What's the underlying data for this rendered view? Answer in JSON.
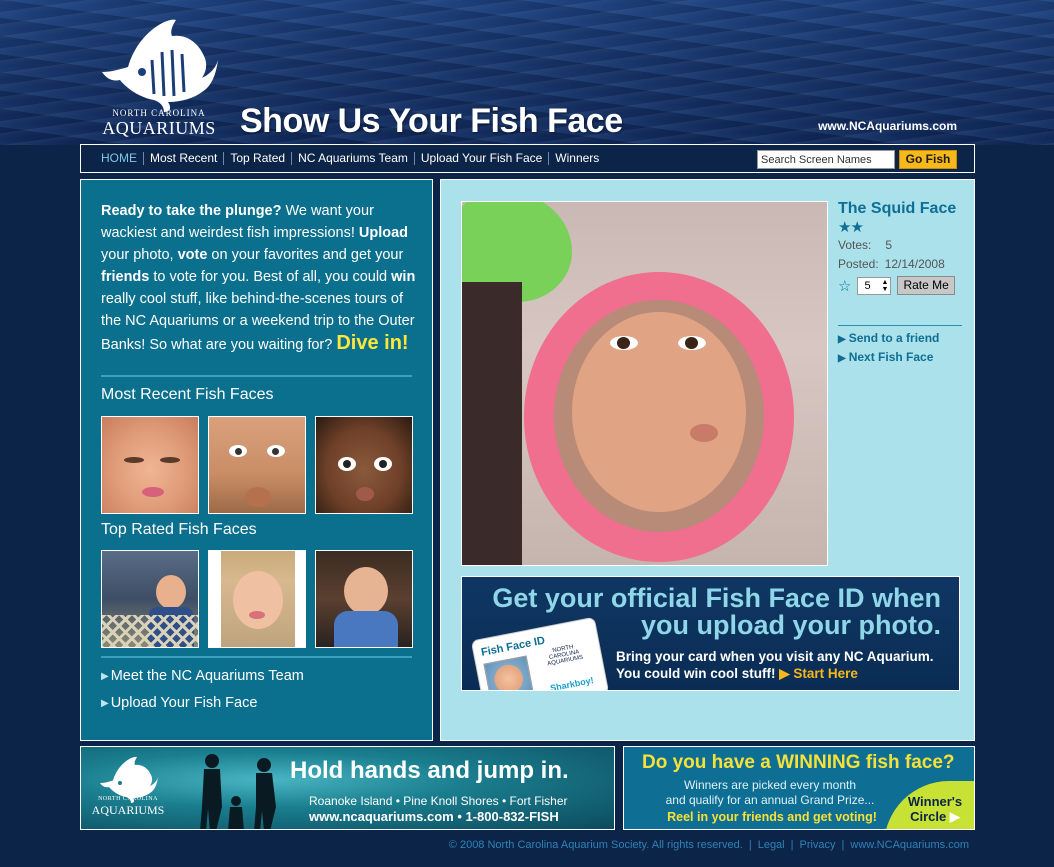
{
  "header": {
    "logo_sub": "NORTH CAROLINA",
    "logo_main": "AQUARIUMS",
    "title": "Show Us Your Fish Face",
    "site_url": "www.NCAquariums.com"
  },
  "nav": {
    "items": [
      {
        "label": "HOME",
        "active": true
      },
      {
        "label": "Most Recent"
      },
      {
        "label": "Top Rated"
      },
      {
        "label": "NC Aquariums Team"
      },
      {
        "label": "Upload Your Fish Face"
      },
      {
        "label": "Winners"
      }
    ],
    "search_placeholder": "Search Screen Names",
    "search_button": "Go Fish"
  },
  "left": {
    "intro_bold1": "Ready to take the plunge?",
    "intro_t1": " We want your wackiest and weirdest fish impressions! ",
    "intro_bold2": "Upload",
    "intro_t2": " your photo, ",
    "intro_bold3": "vote",
    "intro_t3": " on your favorites and get your ",
    "intro_bold4": "friends",
    "intro_t4": " to vote for you. Best of all, you could ",
    "intro_bold5": "win",
    "intro_t5": " really cool stuff, like behind-the-scenes tours of the NC Aquariums or a weekend trip to the Outer Banks! So what are you waiting for? ",
    "intro_dive": "Dive in!",
    "most_recent_title": "Most Recent Fish Faces",
    "top_rated_title": "Top Rated Fish Faces",
    "link_team": "Meet the NC Aquariums Team",
    "link_upload": "Upload Your Fish Face"
  },
  "featured": {
    "title": "The Squid Face",
    "stars": "★★",
    "votes_label": "Votes:",
    "votes_value": "5",
    "posted_label": "Posted:",
    "posted_value": "12/14/2008",
    "rating_value": "5",
    "rate_button": "Rate Me",
    "link_send": "Send to a friend",
    "link_next": "Next Fish Face"
  },
  "id_banner": {
    "headline_line1": "Get your official Fish Face ID when",
    "headline_line2": "you upload your photo.",
    "sub_line1": "Bring your card when you visit any NC Aquarium.",
    "sub_line2": "You could win cool stuff!",
    "cta": "Start Here",
    "card_label": "Fish Face ID",
    "card_logo": "NORTH CAROLINA AQUARIUMS",
    "card_name": "Sharkboy!"
  },
  "banner_left": {
    "logo_sub": "NORTH CAROLINA",
    "logo_main": "AQUARIUMS",
    "headline": "Hold hands and jump in.",
    "places": "Roanoke Island  •  Pine Knoll Shores  •  Fort Fisher",
    "contact": "www.ncaquariums.com  •  1-800-832-FISH"
  },
  "banner_right": {
    "headline": "Do you have a WINNING fish face?",
    "sub_line1": "Winners are picked every month",
    "sub_line2": "and qualify for an annual Grand Prize...",
    "cta": "Reel in your friends and get voting!",
    "circle_line1": "Winner's",
    "circle_line2": "Circle"
  },
  "footer": {
    "copyright": "© 2008 North Carolina Aquarium Society. All rights reserved.",
    "legal": "Legal",
    "privacy": "Privacy",
    "site": "www.NCAquariums.com"
  },
  "colors": {
    "page_bg": "#0c2447",
    "left_panel": "#0b6f8e",
    "right_panel": "#abe1ea",
    "accent_yellow": "#ffe83a",
    "button_gold": "#f6b81a"
  }
}
